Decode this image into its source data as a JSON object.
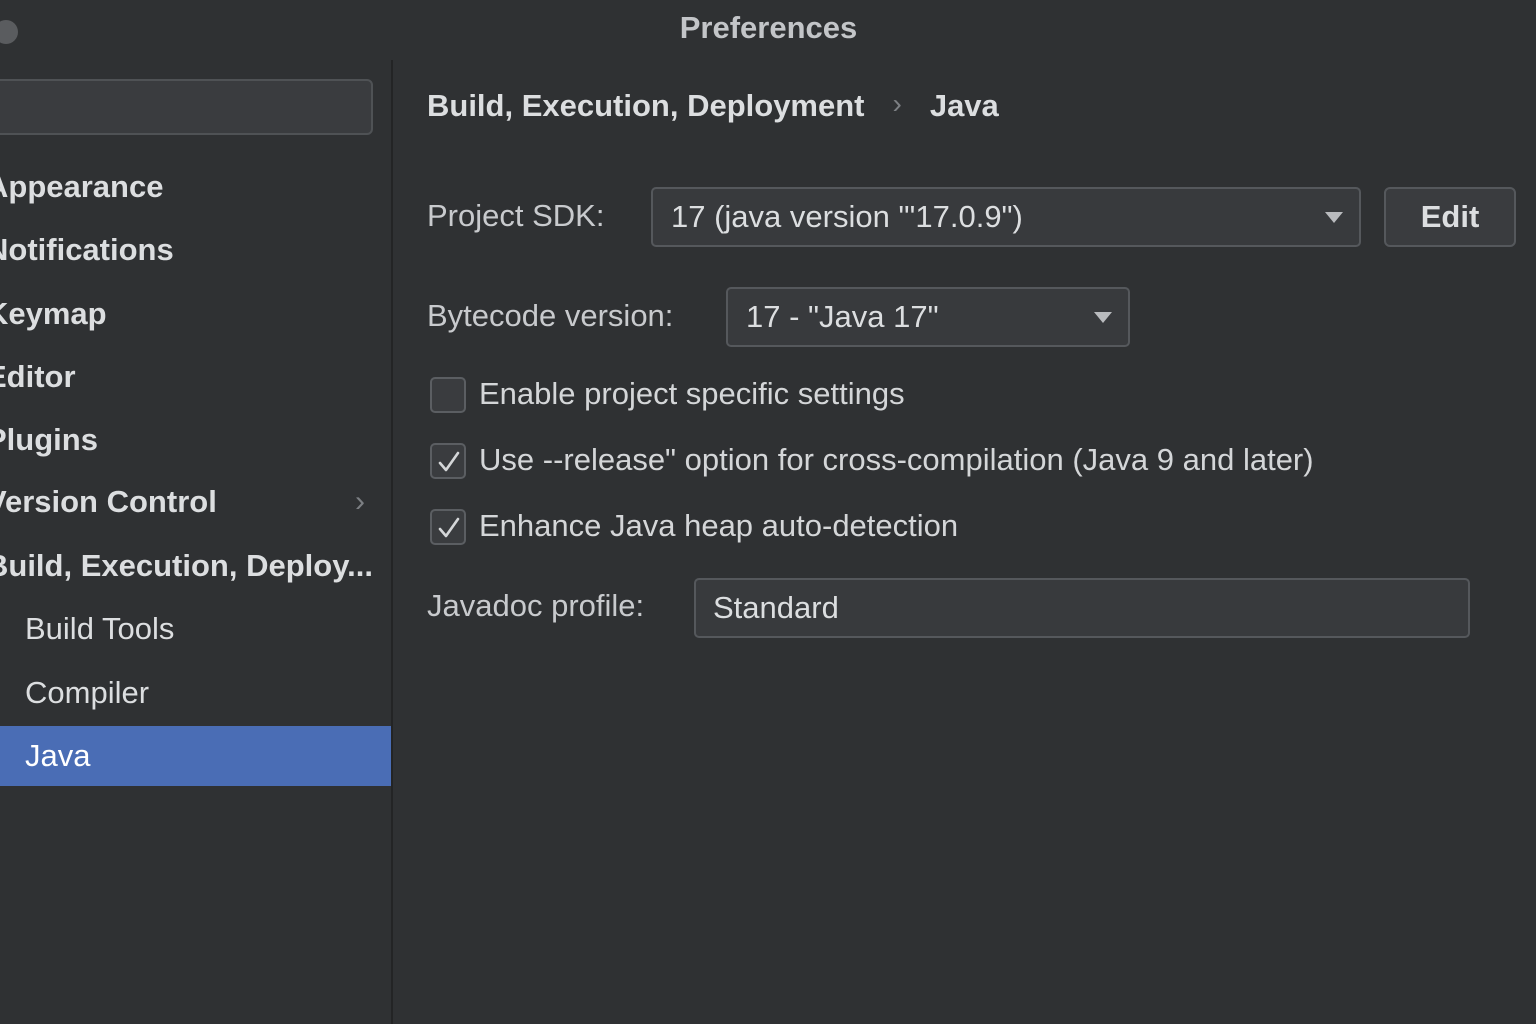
{
  "window": {
    "title": "Preferences"
  },
  "sidebar": {
    "search": {
      "value": "",
      "placeholder": ""
    },
    "items": [
      {
        "label": "Appearance",
        "level": "top",
        "selected": false,
        "expandable": false
      },
      {
        "label": "Notifications",
        "level": "top",
        "selected": false,
        "expandable": false
      },
      {
        "label": "Keymap",
        "level": "top",
        "selected": false,
        "expandable": false
      },
      {
        "label": "Editor",
        "level": "top",
        "selected": false,
        "expandable": false
      },
      {
        "label": "Plugins",
        "level": "top",
        "selected": false,
        "expandable": false
      },
      {
        "label": "Version Control",
        "level": "top",
        "selected": false,
        "expandable": true
      },
      {
        "label": "Build, Execution, Deploy...",
        "level": "top",
        "selected": false,
        "expandable": false
      },
      {
        "label": "Build Tools",
        "level": "child",
        "selected": false,
        "expandable": false
      },
      {
        "label": "Compiler",
        "level": "child",
        "selected": false,
        "expandable": false
      },
      {
        "label": "Java",
        "level": "child",
        "selected": true,
        "expandable": false
      }
    ]
  },
  "breadcrumb": {
    "parent": "Build, Execution, Deployment",
    "current": "Java"
  },
  "settings": {
    "project_sdk": {
      "label": "Project SDK:",
      "value": "17  (java version \"'17.0.9\")",
      "edit_label": "Edit"
    },
    "bytecode_version": {
      "label": "Bytecode version:",
      "value": "17 - \"Java 17\""
    },
    "checkboxes": [
      {
        "label": "Enable project specific settings",
        "checked": false
      },
      {
        "label": "Use --release\" option for cross-compilation (Java 9 and later)",
        "checked": true
      },
      {
        "label": "Enhance Java heap auto-detection",
        "checked": true
      }
    ],
    "javadoc_profile": {
      "label": "Javadoc profile:",
      "value": "Standard"
    }
  },
  "colors": {
    "background": "#2f3133",
    "selection": "#4a6db5",
    "field_background": "#383a3d",
    "border": "#55585c",
    "text": "#d4d6d8"
  }
}
